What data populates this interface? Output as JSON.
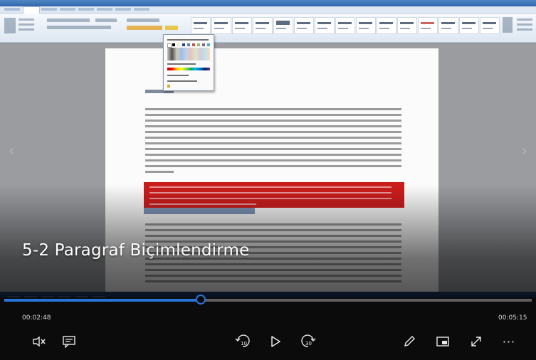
{
  "video": {
    "title": "5-2 Paragraf Biçimlendirme"
  },
  "playback": {
    "elapsed": "00:02:48",
    "total": "00:05:15",
    "progress": 0.372
  },
  "controls": {
    "mute": "volume-muted-icon",
    "captions": "closed-captions-icon",
    "skip_back": "skip-back-10-icon",
    "skip_back_label": "10",
    "play": "play-icon",
    "skip_forward": "skip-forward-30-icon",
    "skip_forward_label": "30",
    "edit": "pen-icon",
    "mini_view": "mini-view-icon",
    "fullscreen": "fullscreen-icon",
    "more": "more-options-icon",
    "more_label": "···"
  },
  "colors": {
    "accent": "#2a73d9",
    "highlight": "#cc1d1d"
  }
}
